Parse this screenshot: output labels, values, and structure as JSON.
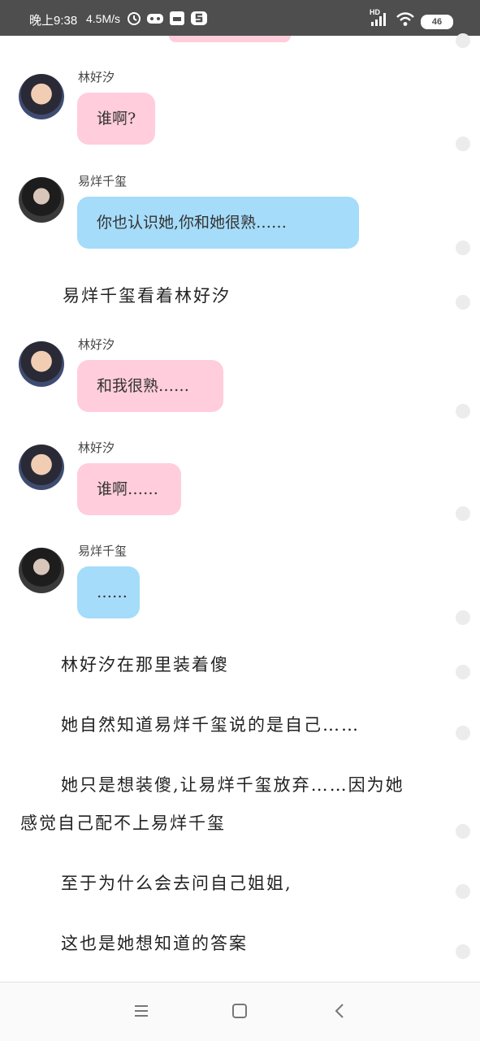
{
  "status_bar": {
    "time": "晚上9:38",
    "speed": "4.5M/s",
    "network_type": "HD",
    "battery": "46",
    "icons": [
      "alarm-icon",
      "game-icon",
      "mi-icon",
      "s-app-icon",
      "signal-icon",
      "wifi-icon",
      "battery-icon"
    ]
  },
  "messages": [
    {
      "speaker": "林好汐",
      "text": "谁啊?",
      "color": "#ffcddb"
    },
    {
      "speaker": "易烊千玺",
      "text": "你也认识她,你和她很熟……",
      "color": "#a5dcfa"
    },
    {
      "narration": "易烊千玺看着林好汐"
    },
    {
      "speaker": "林好汐",
      "text": "和我很熟……",
      "color": "#ffcddb"
    },
    {
      "speaker": "林好汐",
      "text": "谁啊……",
      "color": "#ffcddb"
    },
    {
      "speaker": "易烊千玺",
      "text": "……",
      "color": "#a5dcfa"
    }
  ],
  "narration": [
    {
      "text": "林好汐在那里装着傻"
    },
    {
      "text": "她自然知道易烊千玺说的是自己……"
    },
    {
      "text": "她只是想装傻,让易烊千玺放弃……因为她",
      "text_cont": "感觉自己配不上易烊千玺"
    },
    {
      "text": "至于为什么会去问自己姐姐,"
    },
    {
      "text": "这也是她想知道的答案"
    }
  ],
  "nav_bar": {
    "icons": [
      "menu-icon",
      "home-icon",
      "back-icon"
    ]
  },
  "colors": {
    "pink_bubble": "#ffcddb",
    "blue_bubble": "#a5dcfa",
    "status_bar": "#4e4e4e"
  }
}
